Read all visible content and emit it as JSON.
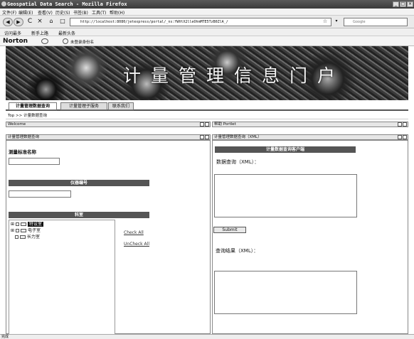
{
  "window": {
    "title": "Geospatial Data Search - Mozilla Firefox"
  },
  "menu": [
    "文件(F)",
    "编辑(E)",
    "查看(V)",
    "历史(S)",
    "书签(B)",
    "工具(T)",
    "帮助(H)"
  ],
  "nav": {
    "url": "http://localhost:8080/jetexpress/portal/_ns:YWVtX2lleOhmMTE5TzB0ZlA_/",
    "search_placeholder": "Google"
  },
  "bookmarks": [
    "访问最多",
    "新手上路",
    "最新头条"
  ],
  "norton": {
    "brand": "Norton",
    "login": "未登录身份名"
  },
  "banner": {
    "title": "计量管理信息门户"
  },
  "tabs": [
    "计量管理数据查询",
    "计量管理子服务",
    "联系我们"
  ],
  "breadcrumb": "Top >> 计量数据查询",
  "welcome": {
    "title": "Welcome"
  },
  "helper": {
    "title": "帮助 Portlet"
  },
  "left_portlet": {
    "title": "计量管理数据查询",
    "std_name_label": "测量标准名称",
    "instrument_label": "仪器编号",
    "dept_label": "科室",
    "tree": [
      "特设室",
      "电子室",
      "长力室"
    ],
    "check_all": "Check All",
    "uncheck_all": "UnCheck All"
  },
  "right_portlet": {
    "title": "计量管理数据查询（XML）",
    "client_header": "计量数据查询客户端",
    "query_label": "数据查询（XML）：",
    "submit": "Submit",
    "result_label": "查询结果（XML）："
  },
  "status": "完成"
}
